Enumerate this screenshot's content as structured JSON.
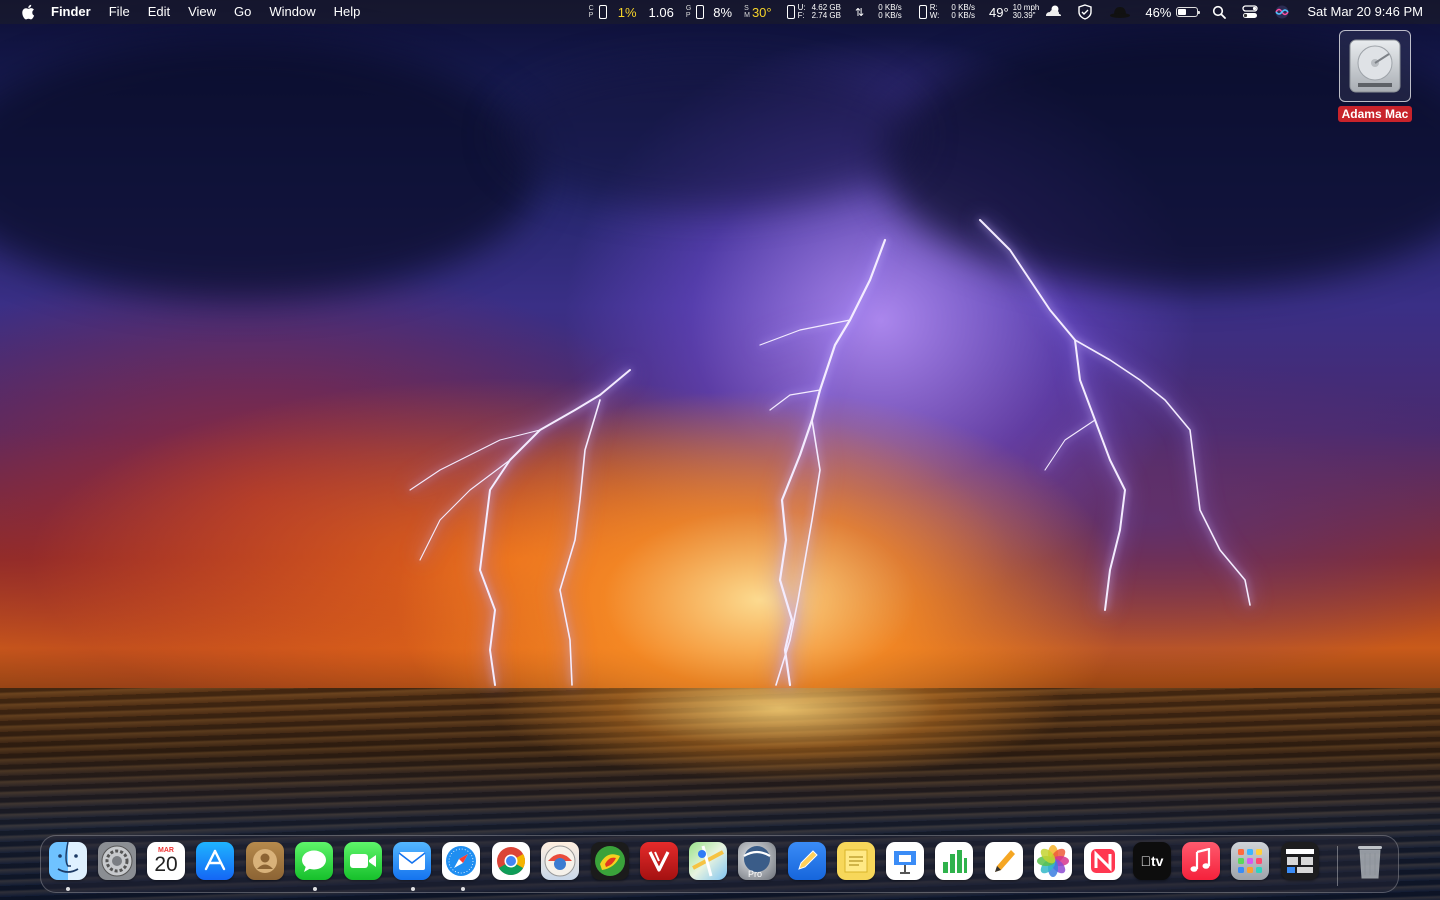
{
  "menubar": {
    "app_name": "Finder",
    "menus": [
      "File",
      "Edit",
      "View",
      "Go",
      "Window",
      "Help"
    ],
    "cpu": {
      "label_top": "C",
      "label_bot": "P",
      "value": "1%"
    },
    "load": "1.06",
    "gpu": {
      "label_top": "G",
      "label_bot": "P",
      "value": "8%"
    },
    "temp": {
      "label_top": "S",
      "label_bot": "M",
      "value": "30°"
    },
    "memory": {
      "used_label": "U:",
      "used": "4.62 GB",
      "free_label": "F:",
      "free": "2.74 GB"
    },
    "network": {
      "up": "0 KB/s",
      "down": "0 KB/s"
    },
    "disk": {
      "read_label": "R:",
      "write_label": "W:",
      "read": "0 KB/s",
      "write": "0 KB/s"
    },
    "weather": {
      "temp": "49°",
      "wind": "10 mph",
      "pressure": "30.39\""
    },
    "battery": {
      "percent_label": "46%",
      "level": 0.46
    },
    "datetime": "Sat Mar 20  9:46 PM",
    "icons": [
      "apple-logo-icon",
      "weather-cloud-icon",
      "shield-icon",
      "hat-icon",
      "battery-icon",
      "search-icon",
      "control-center-icon",
      "siri-icon"
    ]
  },
  "desktop": {
    "drive_label": "Adams Mac",
    "drive_icon": "hard-drive-icon"
  },
  "dock": {
    "calendar": {
      "month": "MAR",
      "day": "20"
    },
    "apps": [
      {
        "name": "Finder",
        "running": true
      },
      {
        "name": "System Preferences",
        "running": false
      },
      {
        "name": "Calendar",
        "running": false
      },
      {
        "name": "App Store",
        "running": false
      },
      {
        "name": "Contacts",
        "running": false
      },
      {
        "name": "Messages",
        "running": true
      },
      {
        "name": "FaceTime",
        "running": false
      },
      {
        "name": "Mail",
        "running": true
      },
      {
        "name": "Safari",
        "running": true
      },
      {
        "name": "Google Chrome",
        "running": false
      },
      {
        "name": "Weather app",
        "running": false
      },
      {
        "name": "Radar app",
        "running": false
      },
      {
        "name": "Vivaldi",
        "running": false
      },
      {
        "name": "Maps",
        "running": false
      },
      {
        "name": "Google Earth Pro",
        "running": false
      },
      {
        "name": "Pages",
        "running": false
      },
      {
        "name": "Stickies",
        "running": false
      },
      {
        "name": "Keynote",
        "running": false
      },
      {
        "name": "Numbers",
        "running": false
      },
      {
        "name": "Pages Writer",
        "running": false
      },
      {
        "name": "Photos",
        "running": false
      },
      {
        "name": "News",
        "running": false
      },
      {
        "name": "Apple TV",
        "running": false
      },
      {
        "name": "Music",
        "running": false
      },
      {
        "name": "Launchpad",
        "running": false
      },
      {
        "name": "Mission Control",
        "running": false
      },
      {
        "name": "Trash",
        "running": false
      }
    ],
    "earth_badge": "Pro",
    "tv_label": "tv",
    "colors": {
      "accent": "#2f7cf6",
      "drive_label_bg": "#c8232b",
      "cpu_text": "#f5d32a"
    }
  }
}
